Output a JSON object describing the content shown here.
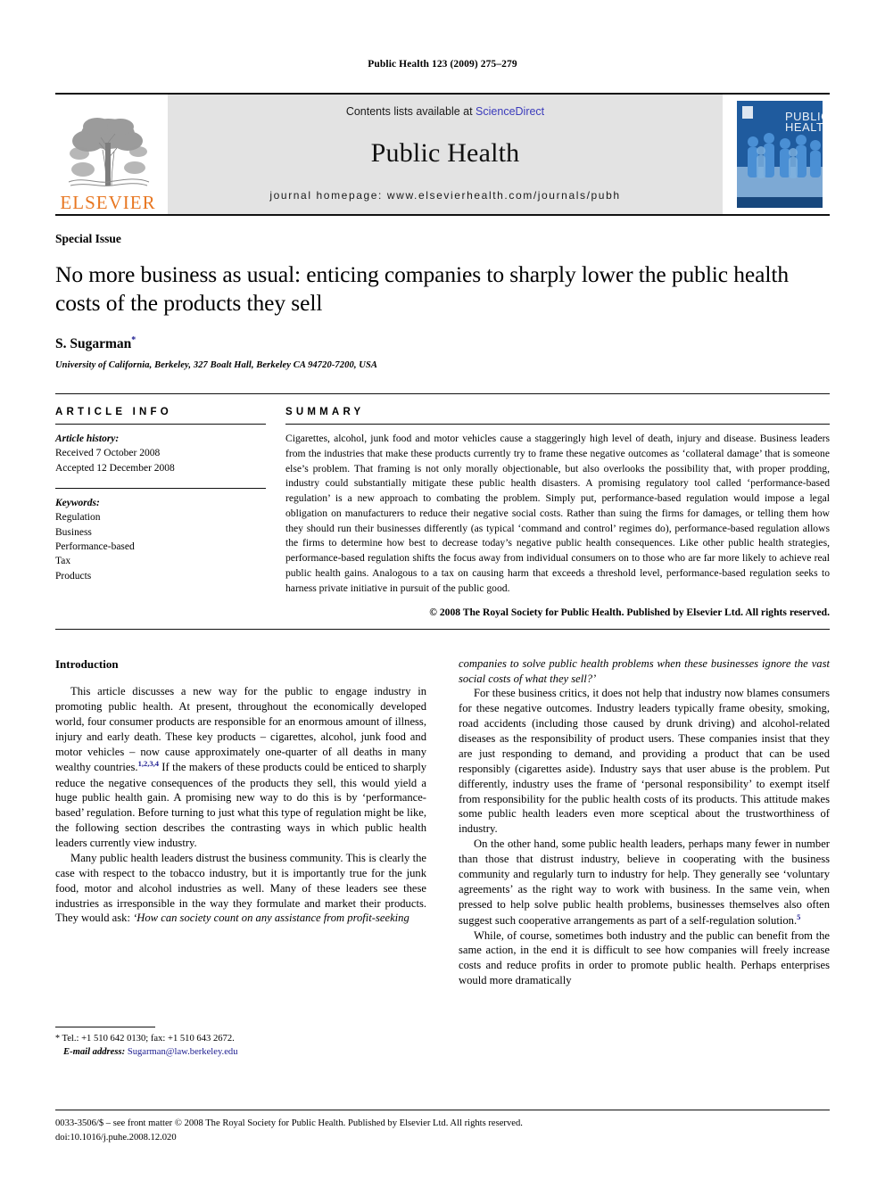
{
  "running_head": "Public Health 123 (2009) 275–279",
  "masthead": {
    "elsevier_wordmark": "ELSEVIER",
    "contents_prefix": "Contents lists available at ",
    "contents_link": "ScienceDirect",
    "journal_name": "Public Health",
    "homepage": "journal homepage: www.elsevierhealth.com/journals/pubh",
    "cover_title_line1": "PUBLIC",
    "cover_title_line2": "HEALTH",
    "cover_color_dark": "#1f5b9e",
    "cover_color_mid": "#4a8fd4",
    "cover_color_light": "#9dc3e6",
    "link_color": "#3b3bbb",
    "elsevier_orange": "#E87722"
  },
  "article": {
    "special_issue": "Special Issue",
    "title": "No more business as usual: enticing companies to sharply lower the public health costs of the products they sell",
    "author": "S. Sugarman",
    "author_marker": "*",
    "affiliation": "University of California, Berkeley, 327 Boalt Hall, Berkeley CA 94720-7200, USA"
  },
  "article_info": {
    "label": "ARTICLE INFO",
    "history_label": "Article history:",
    "history": [
      "Received 7 October 2008",
      "Accepted 12 December 2008"
    ],
    "keywords_label": "Keywords:",
    "keywords": [
      "Regulation",
      "Business",
      "Performance-based",
      "Tax",
      "Products"
    ]
  },
  "summary": {
    "label": "SUMMARY",
    "text": "Cigarettes, alcohol, junk food and motor vehicles cause a staggeringly high level of death, injury and disease. Business leaders from the industries that make these products currently try to frame these negative outcomes as ‘collateral damage’ that is someone else’s problem. That framing is not only morally objectionable, but also overlooks the possibility that, with proper prodding, industry could substantially mitigate these public health disasters. A promising regulatory tool called ‘performance-based regulation’ is a new approach to combating the problem. Simply put, performance-based regulation would impose a legal obligation on manufacturers to reduce their negative social costs. Rather than suing the firms for damages, or telling them how they should run their businesses differently (as typical ‘command and control’ regimes do), performance-based regulation allows the firms to determine how best to decrease today’s negative public health consequences. Like other public health strategies, performance-based regulation shifts the focus away from individual consumers on to those who are far more likely to achieve real public health gains. Analogous to a tax on causing harm that exceeds a threshold level, performance-based regulation seeks to harness private initiative in pursuit of the public good.",
    "copyright": "© 2008 The Royal Society for Public Health. Published by Elsevier Ltd. All rights reserved."
  },
  "body": {
    "heading": "Introduction",
    "left_p1_a": "This article discusses a new way for the public to engage industry in promoting public health. At present, throughout the economically developed world, four consumer products are responsible for an enormous amount of illness, injury and early death. These key products – cigarettes, alcohol, junk food and motor vehicles – now cause approximately one-quarter of all deaths in many wealthy countries.",
    "left_p1_cite": "1,2,3,4",
    "left_p1_b": " If the makers of these products could be enticed to sharply reduce the negative consequences of the products they sell, this would yield a huge public health gain. A promising new way to do this is by ‘performance-based’ regulation. Before turning to just what this type of regulation might be like, the following section describes the contrasting ways in which public health leaders currently view industry.",
    "left_p2_a": "Many public health leaders distrust the business community. This is clearly the case with respect to the tobacco industry, but it is importantly true for the junk food, motor and alcohol industries as well. Many of these leaders see these industries as irresponsible in the way they formulate and market their products. They would ask: ",
    "left_p2_quote": "‘How can society count on any assistance from profit-seeking",
    "right_p1_quote": "companies to solve public health problems when these businesses ignore the vast social costs of what they sell?’",
    "right_p2": "For these business critics, it does not help that industry now blames consumers for these negative outcomes. Industry leaders typically frame obesity, smoking, road accidents (including those caused by drunk driving) and alcohol-related diseases as the responsibility of product users. These companies insist that they are just responding to demand, and providing a product that can be used responsibly (cigarettes aside). Industry says that user abuse is the problem. Put differently, industry uses the frame of ‘personal responsibility’ to exempt itself from responsibility for the public health costs of its products. This attitude makes some public health leaders even more sceptical about the trustworthiness of industry.",
    "right_p3_a": "On the other hand, some public health leaders, perhaps many fewer in number than those that distrust industry, believe in cooperating with the business community and regularly turn to industry for help. They generally see ‘voluntary agreements’ as the right way to work with business. In the same vein, when pressed to help solve public health problems, businesses themselves also often suggest such cooperative arrangements as part of a self-regulation solution.",
    "right_p3_cite": "5",
    "right_p4": "While, of course, sometimes both industry and the public can benefit from the same action, in the end it is difficult to see how companies will freely increase costs and reduce profits in order to promote public health. Perhaps enterprises would more dramatically"
  },
  "footnote": {
    "marker": "*",
    "tel": " Tel.: +1 510 642 0130; fax: +1 510 643 2672.",
    "email_label": "E-mail address:",
    "email": "Sugarman@law.berkeley.edu"
  },
  "page_footer": {
    "line1": "0033-3506/$ – see front matter © 2008 The Royal Society for Public Health. Published by Elsevier Ltd. All rights reserved.",
    "line2": "doi:10.1016/j.puhe.2008.12.020"
  }
}
